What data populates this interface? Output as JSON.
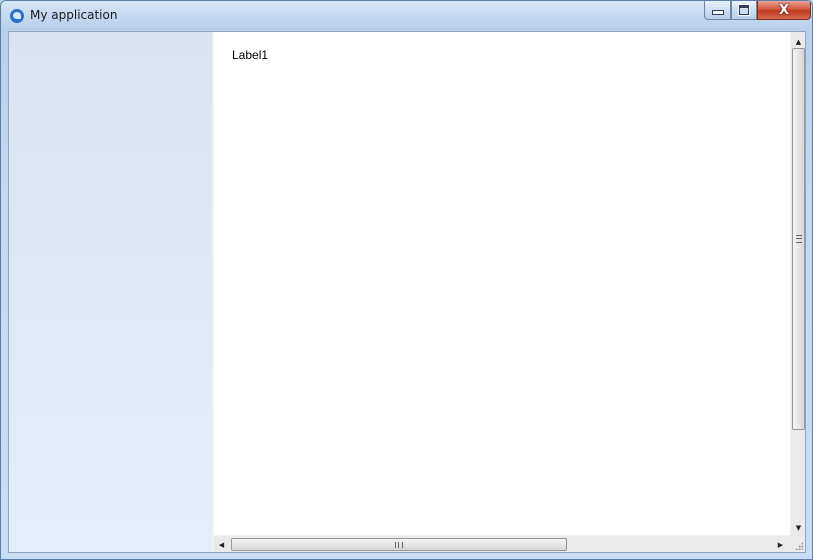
{
  "window": {
    "title": "My application",
    "icon": "app-icon",
    "buttons": {
      "minimize_icon": "minimize-icon",
      "maximize_icon": "maximize-icon",
      "close_icon": "close-icon",
      "close_glyph": "X"
    }
  },
  "content": {
    "label": "Label1"
  },
  "scrollbars": {
    "vertical": {
      "up_glyph": "▲",
      "down_glyph": "▼"
    },
    "horizontal": {
      "left_glyph": "◀",
      "right_glyph": "▶"
    }
  }
}
